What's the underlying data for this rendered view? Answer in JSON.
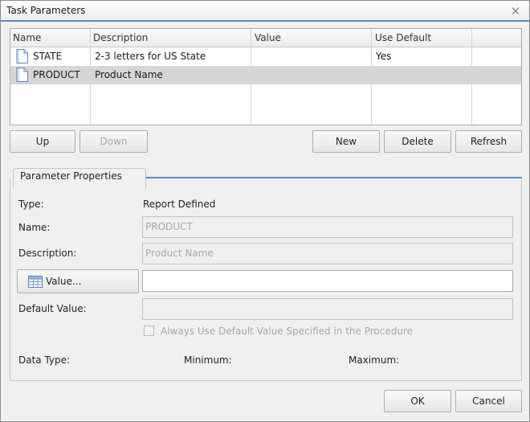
{
  "window": {
    "title": "Task Parameters"
  },
  "grid": {
    "columns": [
      "Name",
      "Description",
      "Value",
      "Use Default"
    ],
    "rows": [
      {
        "name": "STATE",
        "description": "2-3 letters for US State",
        "value": "",
        "use_default": "Yes",
        "selected": false
      },
      {
        "name": "PRODUCT",
        "description": "Product Name",
        "value": "",
        "use_default": "",
        "selected": true
      }
    ]
  },
  "buttons": {
    "up": "Up",
    "down": "Down",
    "new": "New",
    "delete": "Delete",
    "refresh": "Refresh",
    "value": "Value...",
    "ok": "OK",
    "cancel": "Cancel"
  },
  "properties": {
    "group_title": "Parameter Properties",
    "type_label": "Type:",
    "type_value": "Report Defined",
    "name_label": "Name:",
    "name_value": "PRODUCT",
    "description_label": "Description:",
    "description_value": "Product Name",
    "value_field": "",
    "default_value_label": "Default Value:",
    "default_value": "",
    "always_use_default_label": "Always Use Default Value Specified in the Procedure",
    "always_use_default_checked": false,
    "data_type_label": "Data Type:",
    "minimum_label": "Minimum:",
    "maximum_label": "Maximum:"
  },
  "icons": {
    "close": "close-icon",
    "document": "document-icon",
    "table": "table-icon"
  },
  "colors": {
    "accent": "#5b8ac7",
    "selected_row": "#d6d6d6",
    "disabled_text": "#a6a6a6"
  }
}
